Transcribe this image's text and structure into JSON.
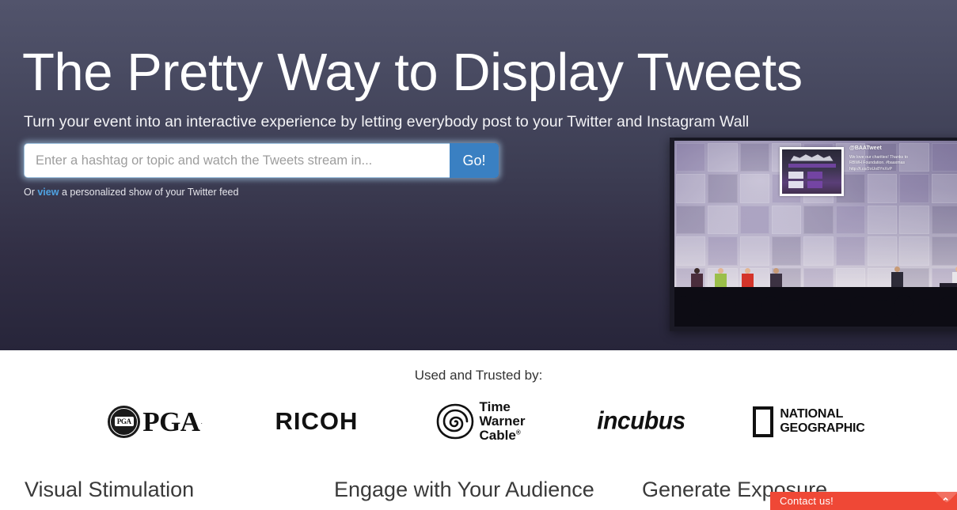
{
  "hero": {
    "title": "The Pretty Way to Display Tweets",
    "subtitle": "Turn your event into an interactive experience by letting everybody post to your Twitter and Instagram Wall",
    "search": {
      "placeholder": "Enter a hashtag or topic and watch the Tweets stream in...",
      "value": "",
      "submit_label": "Go!"
    },
    "note": {
      "before": "Or ",
      "link": "view",
      "after": " a personalized show of your Twitter feed"
    },
    "photo": {
      "tweet_handle": "@BAATweet",
      "tweet_line1": "We love our charities! Thanks to",
      "tweet_line2": "RBWH Foundation. #baaxmas",
      "tweet_line3": "http://t.co/2oUo8YnXvP"
    },
    "colors": {
      "gradient_top": "#52546c",
      "gradient_bottom": "#27253a",
      "go_button": "#3a80c2",
      "link": "#4fa3e3"
    }
  },
  "trust": {
    "title": "Used and Trusted by:",
    "logos": [
      {
        "name": "PGA",
        "seal_text": "PGA",
        "word": "PGA",
        "tm": "."
      },
      {
        "name": "RICOH",
        "word": "RICOH"
      },
      {
        "name": "Time Warner Cable",
        "line1": "Time",
        "line2": "Warner",
        "line3": "Cable",
        "sup": "®"
      },
      {
        "name": "incubus",
        "word": "incubus"
      },
      {
        "name": "National Geographic",
        "line1": "NATIONAL",
        "line2": "GEOGRAPHIC"
      }
    ]
  },
  "features": {
    "items": [
      {
        "heading": "Visual Stimulation"
      },
      {
        "heading": "Engage with Your Audience"
      },
      {
        "heading": "Generate Exposure"
      }
    ]
  },
  "contact": {
    "label": "Contact us!",
    "chevron": "⌃",
    "color": "#ef4836"
  }
}
